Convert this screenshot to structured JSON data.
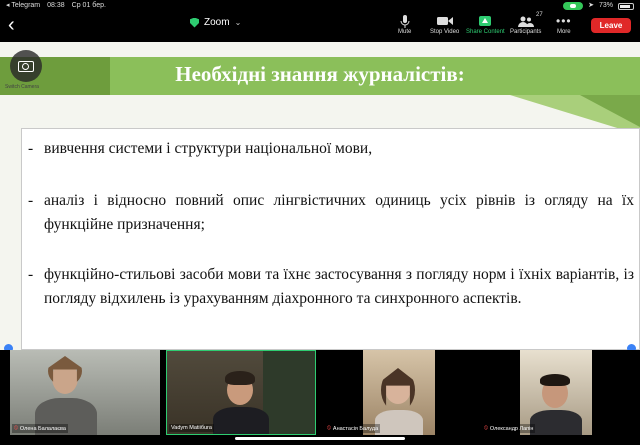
{
  "status_bar": {
    "app": "◂ Telegram",
    "time": "08:38",
    "date": "Ср 01 бер.",
    "battery": "73%"
  },
  "toolbar": {
    "back": "‹",
    "title": "Zoom",
    "mute": "Mute",
    "stop_video": "Stop Video",
    "share_content": "Share Content",
    "participants": "Participants",
    "participants_count": "27",
    "more": "More",
    "leave": "Leave"
  },
  "colors": {
    "accent_green": "#2ecc71",
    "leave_red": "#e02828",
    "slide_green": "#8bbf5a"
  },
  "camera": {
    "switch_label": "Switch Camera"
  },
  "slide": {
    "title": "Необхідні знання журналістів:",
    "bullets": [
      {
        "dash": "-",
        "text": "вивчення системи і структури національної мови,"
      },
      {
        "dash": "-",
        "text": "аналіз і відносно повний опис лінгвістичних одиниць усіх рівнів із огляду на їх функційне призначення;"
      },
      {
        "dash": "-",
        "text": "функційно-стильові засоби мови та їхнє застосування з погляду норм і їхніх варіантів, із погляду відхилень із урахуванням діахронного та синхронного аспектів."
      }
    ]
  },
  "participants": [
    {
      "name": "Олена Балалаєва"
    },
    {
      "name": "Vadym Matiiбura"
    },
    {
      "name": "Анастасія Балуда"
    },
    {
      "name": "Олександр Лапін"
    }
  ]
}
